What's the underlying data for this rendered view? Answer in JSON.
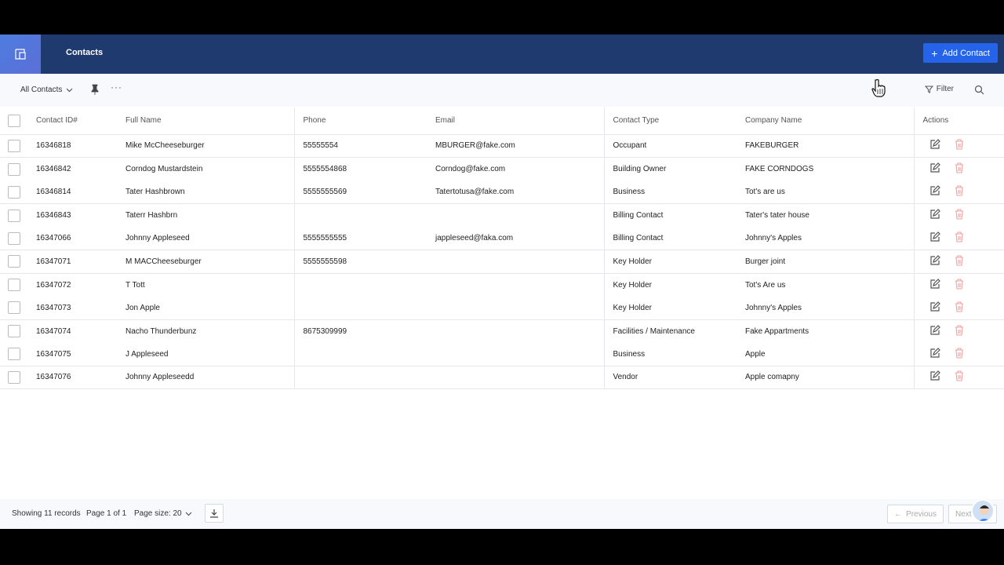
{
  "header": {
    "title": "Contacts",
    "add_button": "Add Contact"
  },
  "toolbar": {
    "view": "All Contacts",
    "more": "···",
    "filter": "Filter"
  },
  "table": {
    "columns": [
      "Contact ID#",
      "Full Name",
      "Phone",
      "Email",
      "Contact Type",
      "Company Name",
      "Actions"
    ],
    "rows": [
      {
        "id": "16346818",
        "name": "Mike McCheeseburger",
        "phone": "55555554",
        "email": "MBURGER@fake.com",
        "type": "Occupant",
        "company": "FAKEBURGER"
      },
      {
        "id": "16346842",
        "name": "Corndog Mustardstein",
        "phone": "5555554868",
        "email": "Corndog@fake.com",
        "type": "Building Owner",
        "company": "FAKE CORNDOGS"
      },
      {
        "id": "16346814",
        "name": "Tater Hashbrown",
        "phone": "5555555569",
        "email": "Tatertotusa@fake.com",
        "type": "Business",
        "company": "Tot's are us"
      },
      {
        "id": "16346843",
        "name": "Taterr Hashbrn",
        "phone": "",
        "email": "",
        "type": "Billing Contact",
        "company": "Tater's tater house"
      },
      {
        "id": "16347066",
        "name": "Johnny Appleseed",
        "phone": "5555555555",
        "email": "jappleseed@faka.com",
        "type": "Billing Contact",
        "company": "Johnny's Apples"
      },
      {
        "id": "16347071",
        "name": "M MACCheeseburger",
        "phone": "5555555598",
        "email": "",
        "type": "Key Holder",
        "company": "Burger joint"
      },
      {
        "id": "16347072",
        "name": "T Tott",
        "phone": "",
        "email": "",
        "type": "Key Holder",
        "company": "Tot's Are us"
      },
      {
        "id": "16347073",
        "name": "Jon Apple",
        "phone": "",
        "email": "",
        "type": "Key Holder",
        "company": "Johnny's Apples"
      },
      {
        "id": "16347074",
        "name": "Nacho Thunderbunz",
        "phone": "8675309999",
        "email": "",
        "type": "Facilities / Maintenance",
        "company": "Fake Appartments"
      },
      {
        "id": "16347075",
        "name": "J Appleseed",
        "phone": "",
        "email": "",
        "type": "Business",
        "company": "Apple"
      },
      {
        "id": "16347076",
        "name": "Johnny Appleseedd",
        "phone": "",
        "email": "",
        "type": "Vendor",
        "company": "Apple comapny"
      }
    ]
  },
  "footer": {
    "records": "Showing 11 records",
    "page": "Page 1 of 1",
    "page_size": "Page size: 20",
    "previous": "Previous",
    "next": "Next"
  },
  "colors": {
    "header_bg": "#1f3a6e",
    "accent": "#2563eb",
    "delete": "#f0a0a0"
  }
}
